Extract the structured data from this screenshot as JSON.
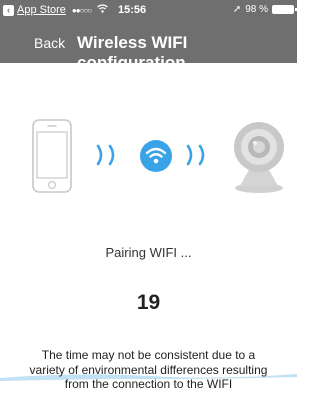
{
  "status_bar": {
    "back_label": "App Store",
    "signal": "●●○○○",
    "time": "15:56",
    "battery": "98 %"
  },
  "nav": {
    "back": "Back",
    "title": "Wireless WIFI configuration"
  },
  "main": {
    "status": "Pairing WIFI ...",
    "countdown": "19",
    "note": "The time may not be consistent due to a variety of environmental differences resulting from the connection to the WIFI"
  },
  "colors": {
    "header_bg": "#6f6f6f",
    "wifi_accent": "#3aa3e8",
    "device_gray": "#c8c8c8"
  }
}
